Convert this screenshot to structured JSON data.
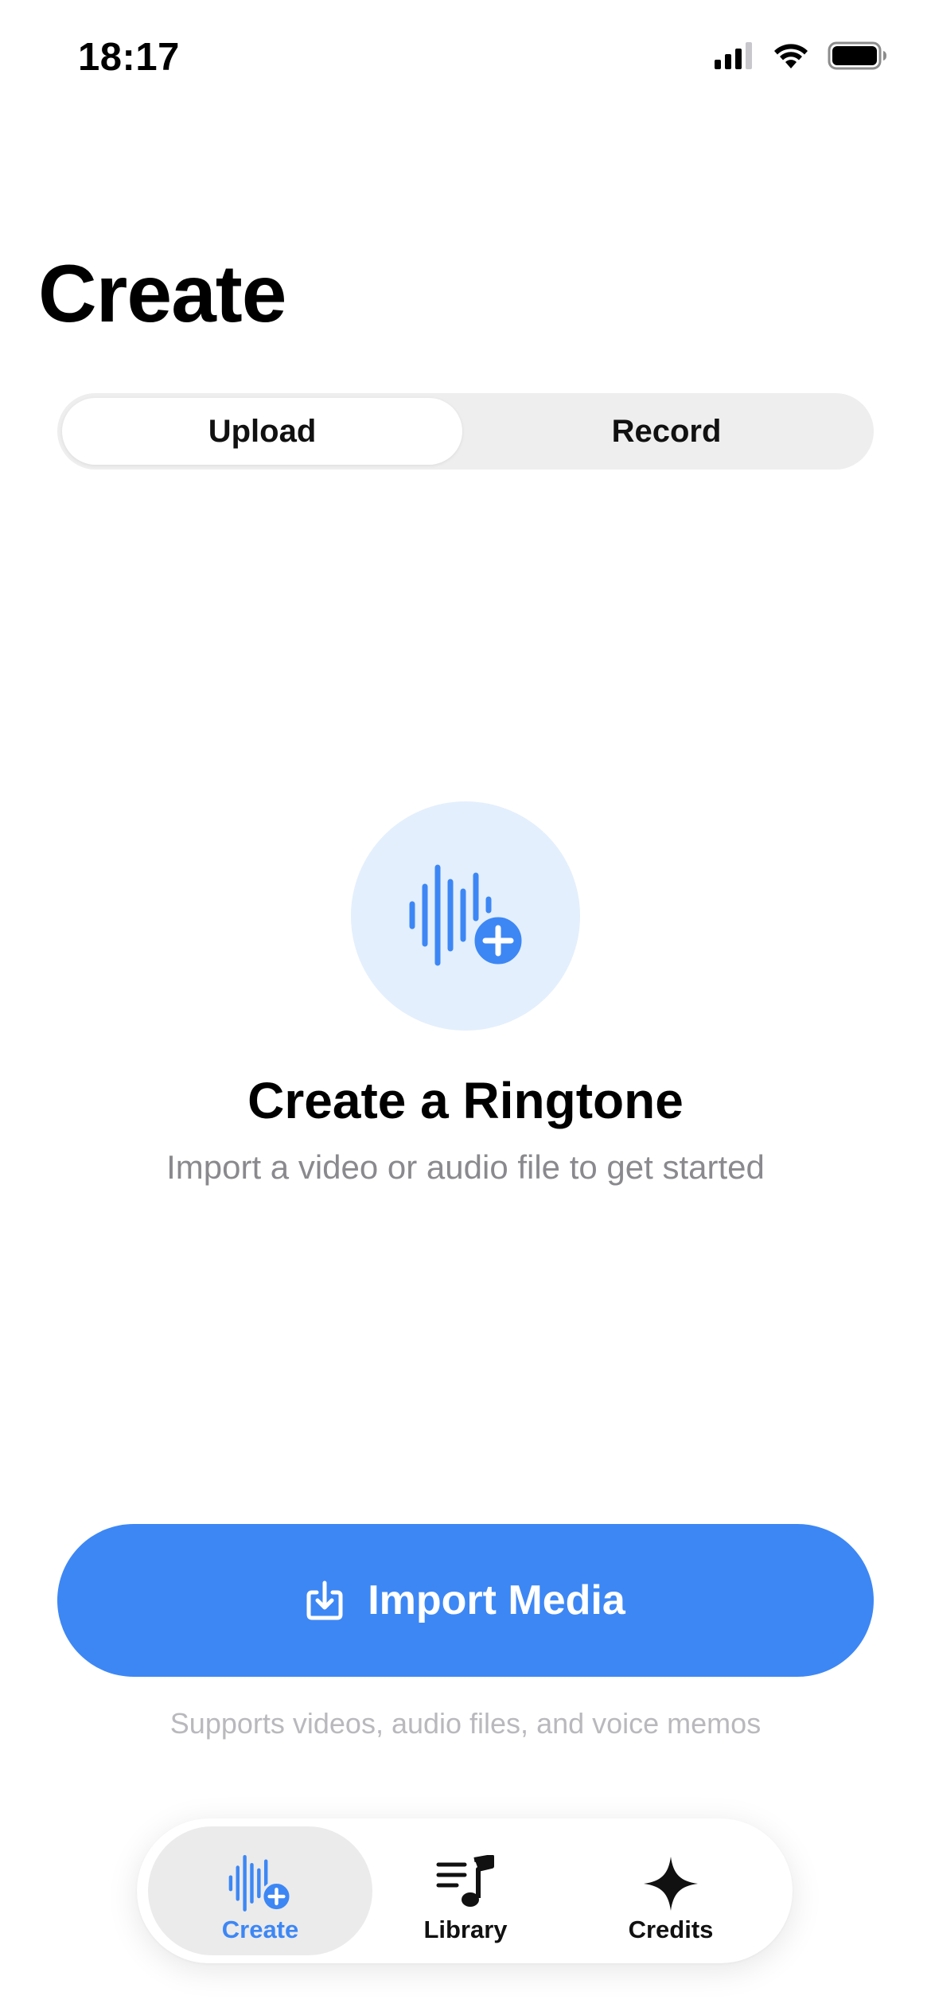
{
  "status_bar": {
    "time": "18:17",
    "icons": [
      "cellular-signal-icon",
      "wifi-icon",
      "battery-icon"
    ]
  },
  "page": {
    "title": "Create"
  },
  "segmented_control": {
    "segments": [
      {
        "label": "Upload",
        "selected": true
      },
      {
        "label": "Record",
        "selected": false
      }
    ]
  },
  "hero": {
    "icon": "waveform-add-icon",
    "title": "Create a Ringtone",
    "subtitle": "Import a video or audio file to get started"
  },
  "import": {
    "button_label": "Import Media",
    "button_icon": "import-tray-icon",
    "note": "Supports videos, audio files, and voice memos"
  },
  "tab_bar": {
    "items": [
      {
        "label": "Create",
        "icon": "waveform-add-icon",
        "active": true
      },
      {
        "label": "Library",
        "icon": "music-list-icon",
        "active": false
      },
      {
        "label": "Credits",
        "icon": "sparkle-icon",
        "active": false
      }
    ]
  },
  "colors": {
    "accent": "#3d87f5",
    "hero_circle": "#e3effd",
    "segment_track": "#eeeeee",
    "secondary_text": "#8a8a8e",
    "tertiary_text": "#b9b9bd"
  }
}
